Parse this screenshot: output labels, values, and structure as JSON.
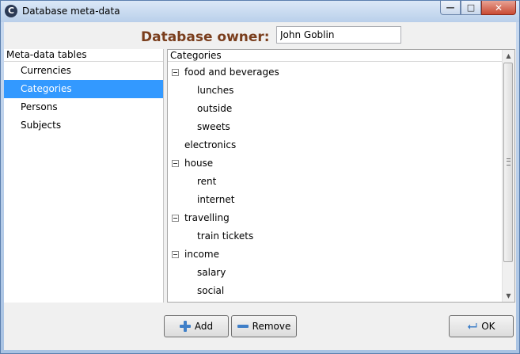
{
  "window": {
    "title": "Database meta-data",
    "app_icon_glyph": "C"
  },
  "header": {
    "owner_label": "Database owner:",
    "owner_value": "John Goblin"
  },
  "left_panel": {
    "header": "Meta-data tables",
    "items": [
      {
        "label": "Currencies",
        "selected": false
      },
      {
        "label": "Categories",
        "selected": true
      },
      {
        "label": "Persons",
        "selected": false
      },
      {
        "label": "Subjects",
        "selected": false
      }
    ]
  },
  "right_panel": {
    "header": "Categories",
    "tree": [
      {
        "label": "food and beverages",
        "level": 0,
        "expanded": true
      },
      {
        "label": "lunches",
        "level": 1
      },
      {
        "label": "outside",
        "level": 1
      },
      {
        "label": "sweets",
        "level": 1
      },
      {
        "label": "electronics",
        "level": 0
      },
      {
        "label": "house",
        "level": 0,
        "expanded": true
      },
      {
        "label": "rent",
        "level": 1
      },
      {
        "label": "internet",
        "level": 1
      },
      {
        "label": "travelling",
        "level": 0,
        "expanded": true
      },
      {
        "label": "train tickets",
        "level": 1
      },
      {
        "label": "income",
        "level": 0,
        "expanded": true
      },
      {
        "label": "salary",
        "level": 1
      },
      {
        "label": "social",
        "level": 1
      }
    ]
  },
  "buttons": {
    "add": "Add",
    "remove": "Remove",
    "ok": "OK"
  },
  "icons": {
    "add": "plus-icon",
    "remove": "minus-icon",
    "ok": "enter-arrow-icon",
    "collapse": "collapse-box-icon"
  },
  "colors": {
    "selection": "#3399ff",
    "owner_label": "#7a3e1d",
    "icon_accent": "#3f7fc8"
  }
}
